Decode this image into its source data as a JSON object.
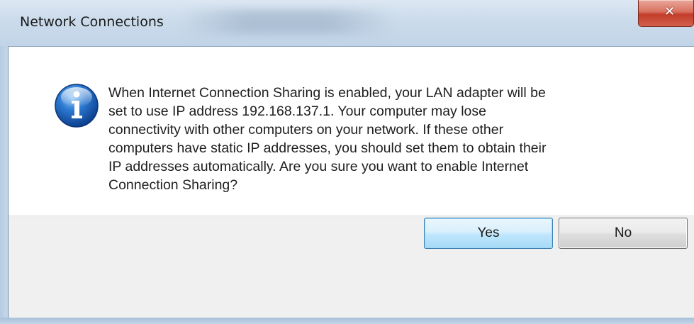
{
  "window": {
    "title": "Network Connections",
    "close_glyph": "✕"
  },
  "dialog": {
    "icon": "info-icon",
    "message_lines": [
      "When Internet Connection Sharing is enabled, your LAN adapter will be",
      "set to use IP address 192.168.137.1. Your computer may lose",
      "connectivity with other computers on your network. If these other",
      "computers have static IP addresses, you should set them to obtain their",
      "IP addresses automatically.  Are you sure you want to enable Internet",
      "Connection Sharing?"
    ]
  },
  "buttons": {
    "yes_label": "Yes",
    "no_label": "No"
  },
  "colors": {
    "titlebar": "#cbdbeb",
    "close_red": "#c43d2a",
    "default_button_border": "#3c7fb1",
    "button_strip": "#f0f0f0"
  }
}
